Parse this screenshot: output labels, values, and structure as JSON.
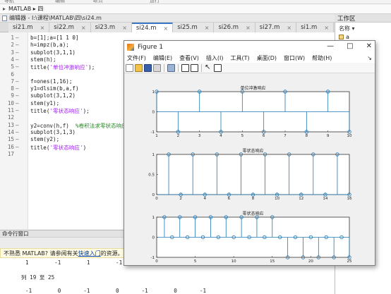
{
  "ribbon": {
    "items": [
      "导航",
      "编辑",
      "断点",
      "运行"
    ]
  },
  "pathbar": {
    "prefix": "▸",
    "path": "MATLAB ▸ 四"
  },
  "editor": {
    "title": "编辑器 - I:\\课程\\MATLAB\\四\\si24.m",
    "tabs": [
      {
        "label": "si21.m",
        "active": false
      },
      {
        "label": "si22.m",
        "active": false
      },
      {
        "label": "si23.m",
        "active": false
      },
      {
        "label": "si24.m",
        "active": true
      },
      {
        "label": "si25.m",
        "active": false
      },
      {
        "label": "si26.m",
        "active": false
      },
      {
        "label": "si27.m",
        "active": false
      },
      {
        "label": "si1.m",
        "active": false
      },
      {
        "label": "si2.m",
        "active": false
      }
    ],
    "tab_close": "×",
    "tab_add": "+",
    "lines": [
      {
        "n": "1",
        "d": "—",
        "parts": [
          {
            "t": "b=[1];a=[1 1 0]",
            "c": ""
          }
        ]
      },
      {
        "n": "2",
        "d": "—",
        "parts": [
          {
            "t": "h=impz(b,a);",
            "c": ""
          }
        ]
      },
      {
        "n": "3",
        "d": "—",
        "parts": [
          {
            "t": "subplot(3,1,1)",
            "c": ""
          }
        ]
      },
      {
        "n": "4",
        "d": "—",
        "parts": [
          {
            "t": "stem(h);",
            "c": ""
          }
        ]
      },
      {
        "n": "5",
        "d": "—",
        "parts": [
          {
            "t": "title(",
            "c": ""
          },
          {
            "t": "'单位冲激响应'",
            "c": "str"
          },
          {
            "t": ");",
            "c": ""
          }
        ]
      },
      {
        "n": "6",
        "d": "",
        "parts": []
      },
      {
        "n": "7",
        "d": "—",
        "parts": [
          {
            "t": "f=ones(1,16);",
            "c": ""
          }
        ]
      },
      {
        "n": "8",
        "d": "—",
        "parts": [
          {
            "t": "y1=dlsim(b,a,f)",
            "c": ""
          }
        ]
      },
      {
        "n": "9",
        "d": "—",
        "parts": [
          {
            "t": "subplot(3,1,2)",
            "c": ""
          }
        ]
      },
      {
        "n": "10",
        "d": "—",
        "parts": [
          {
            "t": "stem(y1);",
            "c": ""
          }
        ]
      },
      {
        "n": "11",
        "d": "—",
        "parts": [
          {
            "t": "title(",
            "c": ""
          },
          {
            "t": "'零状态响应'",
            "c": "str"
          },
          {
            "t": ");",
            "c": ""
          }
        ]
      },
      {
        "n": "12",
        "d": "",
        "parts": []
      },
      {
        "n": "13",
        "d": "—",
        "parts": [
          {
            "t": "y2=conv(h,f)  ",
            "c": ""
          },
          {
            "t": "%卷积法求零状态响应",
            "c": "cmt"
          }
        ]
      },
      {
        "n": "14",
        "d": "—",
        "parts": [
          {
            "t": "subplot(3,1,3)",
            "c": ""
          }
        ]
      },
      {
        "n": "15",
        "d": "—",
        "parts": [
          {
            "t": "stem(y2);",
            "c": ""
          }
        ]
      },
      {
        "n": "16",
        "d": "—",
        "parts": [
          {
            "t": "title(",
            "c": ""
          },
          {
            "t": "'零状态响应'",
            "c": "str"
          },
          {
            "t": ")",
            "c": ""
          }
        ]
      },
      {
        "n": "17",
        "d": "",
        "parts": []
      }
    ]
  },
  "workspace": {
    "title": "工作区",
    "col": "名称 ▾",
    "var": "a"
  },
  "command": {
    "title": "命令行窗口",
    "banner_pre": "不熟悉 MATLAB? 请参阅有关",
    "banner_link": "快速入门",
    "banner_post": "的资源。",
    "lines": [
      "1        -1        1        -1        1        -1",
      "",
      "列 19 至 25",
      "",
      "-1        0       -1        0       -1        0       -1"
    ]
  },
  "figure": {
    "title": "Figure 1",
    "ctrl_min": "—",
    "ctrl_max": "□",
    "ctrl_close": "✕",
    "menu": [
      "文件(F)",
      "编辑(E)",
      "查看(V)",
      "插入(I)",
      "工具(T)",
      "桌面(D)",
      "窗口(W)",
      "帮助(H)"
    ],
    "menu_pin": "↘"
  },
  "chart_data": [
    {
      "type": "stem",
      "title": "单位冲激响应",
      "x": [
        1,
        2,
        3,
        4,
        5,
        6,
        7,
        8,
        9,
        10
      ],
      "values": [
        1,
        -1,
        1,
        -1,
        1,
        -1,
        1,
        -1,
        1,
        -1
      ],
      "xlim": [
        1,
        10
      ],
      "ylim": [
        -1,
        1
      ],
      "xticks": [
        1,
        2,
        3,
        4,
        5,
        6,
        7,
        8,
        9,
        10
      ],
      "yticks": [
        -1,
        0,
        1
      ],
      "color": "#1f77b4"
    },
    {
      "type": "stem",
      "title": "零状态响应",
      "x": [
        1,
        2,
        3,
        4,
        5,
        6,
        7,
        8,
        9,
        10,
        11,
        12,
        13,
        14,
        15,
        16
      ],
      "values": [
        1,
        0,
        1,
        0,
        1,
        0,
        1,
        0,
        1,
        0,
        1,
        0,
        1,
        0,
        1,
        0
      ],
      "xlim": [
        0,
        16
      ],
      "ylim": [
        0,
        1
      ],
      "xticks": [
        0,
        2,
        4,
        6,
        8,
        10,
        12,
        14,
        16
      ],
      "yticks": [
        0,
        0.5,
        1
      ],
      "color": "#1f77b4"
    },
    {
      "type": "stem",
      "title": "零状态响应",
      "x": [
        1,
        2,
        3,
        4,
        5,
        6,
        7,
        8,
        9,
        10,
        11,
        12,
        13,
        14,
        15,
        16,
        17,
        18,
        19,
        20,
        21,
        22,
        23,
        24,
        25
      ],
      "values": [
        1,
        0,
        1,
        0,
        1,
        0,
        1,
        0,
        1,
        0,
        1,
        0,
        1,
        0,
        1,
        0,
        -1,
        0,
        -1,
        0,
        -1,
        0,
        -1,
        0,
        -1
      ],
      "xlim": [
        0,
        25
      ],
      "ylim": [
        -1,
        1
      ],
      "xticks": [
        0,
        5,
        10,
        15,
        20,
        25
      ],
      "yticks": [
        -1,
        0,
        1
      ],
      "color": "#1f77b4"
    }
  ]
}
